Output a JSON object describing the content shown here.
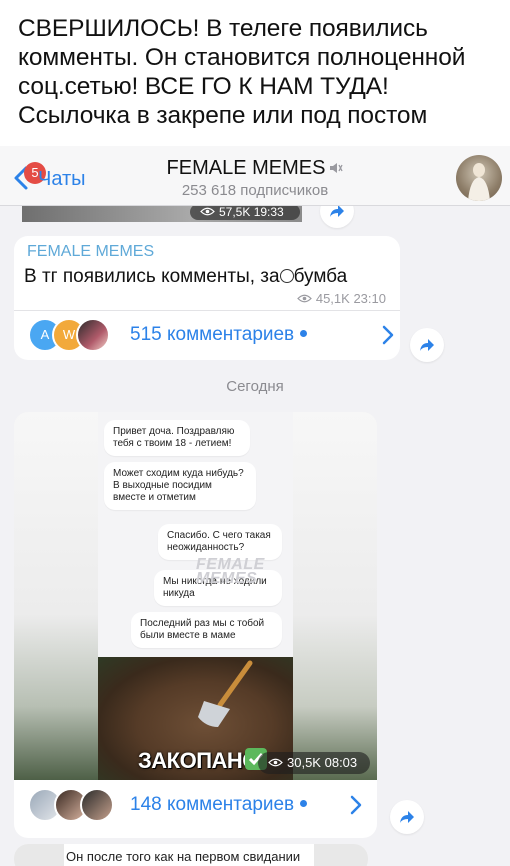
{
  "caption": "СВЕРШИЛОСЬ! В телеге появились комменты. Он становится полноценной соц.сетью! ВСЕ ГО К НАМ ТУДА! Ссылочка в закрепе или под постом",
  "header": {
    "back_label": "Чаты",
    "unread_badge": "5",
    "title": "FEMALE MEMES",
    "subscribers": "253 618 подписчиков"
  },
  "prev_post": {
    "views_time": "57,5K 19:33"
  },
  "post1": {
    "channel_name": "FEMALE MEMES",
    "text": "В тг появились комменты, за",
    "text_end": "бумба",
    "views": "45,1K",
    "time": "23:10",
    "comments_label": "515 комментариев",
    "avatars": [
      "A",
      "W"
    ]
  },
  "date_separator": "Сегодня",
  "post2": {
    "messages": [
      "Привет доча. Поздравляю тебя с твоим 18 - летием!",
      "Может сходим куда нибудь? В выходные посидим вместе и отметим",
      "Спасибо. С чего такая неожиданность?",
      "Мы никогда не ходили никуда",
      "Последний раз мы с тобой были вместе в маме"
    ],
    "watermark": "FEMALE MEMES",
    "caption_overlay": "ЗАКОПАНО",
    "views": "30,5K",
    "time": "08:03",
    "comments_label": "148 комментариев"
  },
  "post3": {
    "text": "Он после того как на первом свидании"
  },
  "colors": {
    "accent": "#2c82e8",
    "channel_name": "#5fa9d8",
    "badge": "#e44c45"
  },
  "icons": [
    "chevron-left-icon",
    "mute-icon",
    "eye-icon",
    "share-icon",
    "chevron-right-icon",
    "shovel-icon",
    "check-icon"
  ]
}
